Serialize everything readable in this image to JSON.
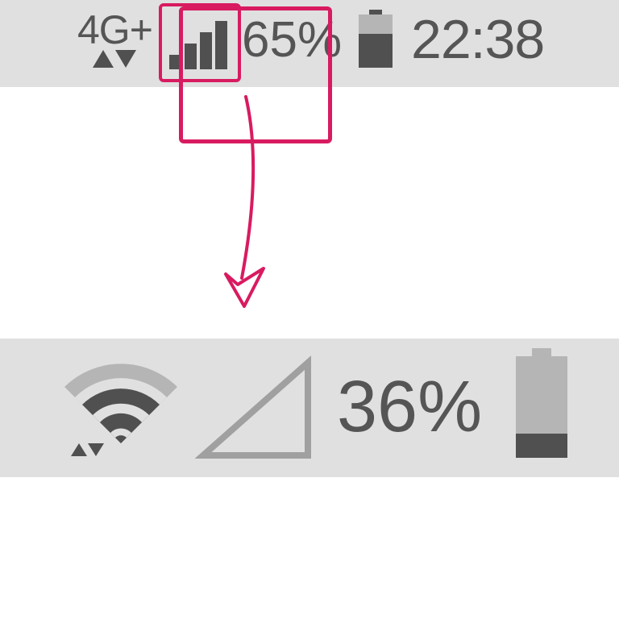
{
  "bar1": {
    "network_label": "4G+",
    "signal_bars": 4,
    "battery_percent": "65%",
    "time": "22:38",
    "battery_fill": 0.65
  },
  "bar2": {
    "battery_percent": "36%",
    "signal_bars": 0,
    "battery_fill": 0.24
  },
  "annotation": {
    "color": "#d81b60"
  }
}
